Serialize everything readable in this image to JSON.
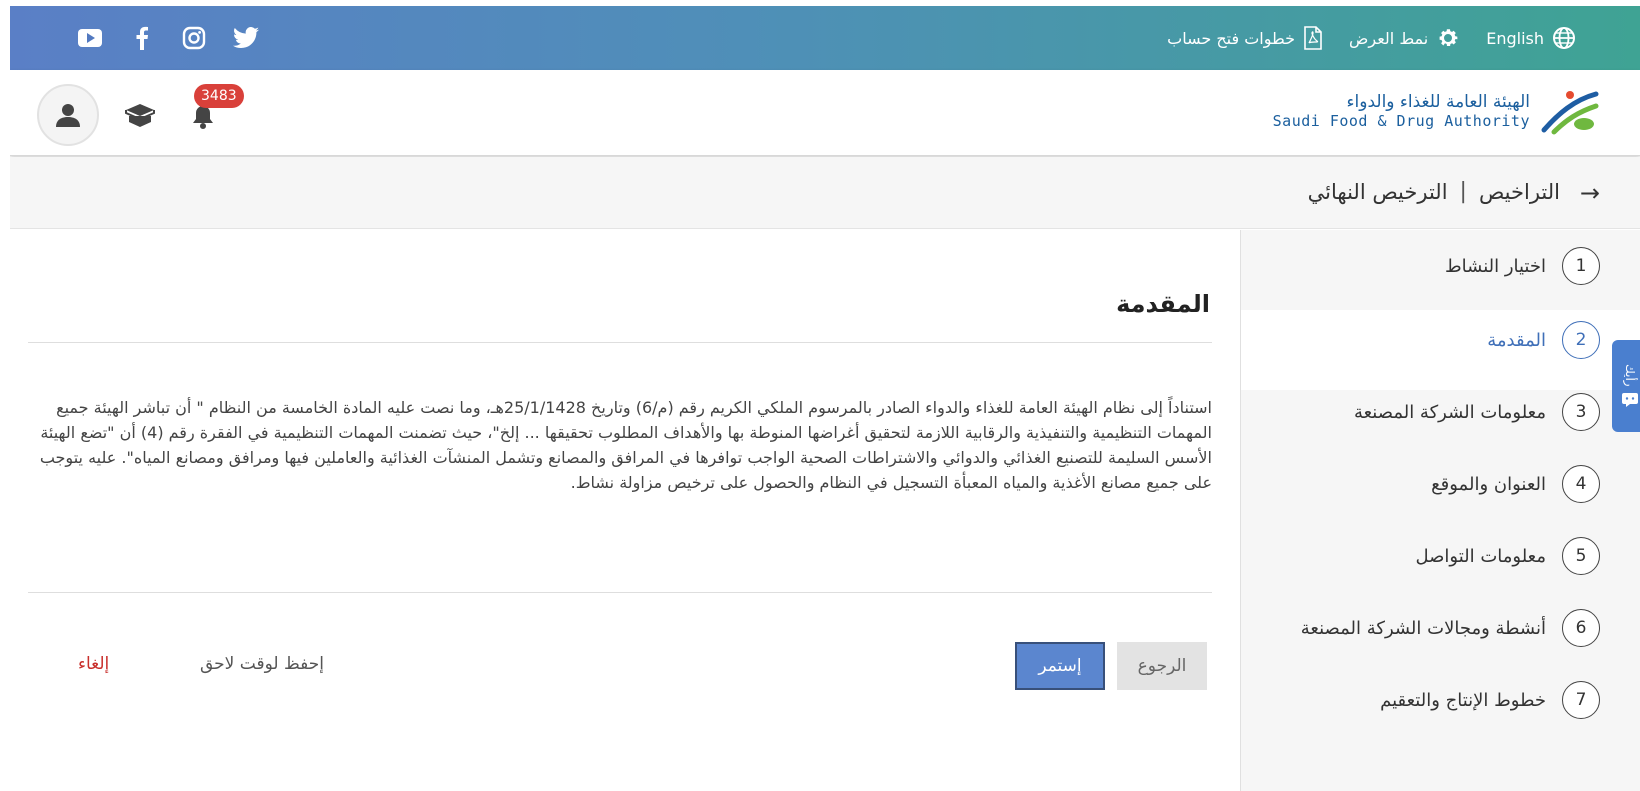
{
  "topbar": {
    "language": "English",
    "display_mode": "نمط العرض",
    "account_steps": "خطوات فتح حساب",
    "social": [
      "youtube-icon",
      "facebook-icon",
      "instagram-icon",
      "twitter-icon"
    ]
  },
  "header": {
    "logo_ar": "الهيئة العامة للغذاء والدواء",
    "logo_en": "Saudi Food & Drug Authority",
    "notification_count": "3483"
  },
  "breadcrumb": {
    "parent": "التراخيص",
    "separator": "|",
    "current": "الترخيص النهائي"
  },
  "steps": [
    {
      "num": "1",
      "label": "اختيار النشاط"
    },
    {
      "num": "2",
      "label": "المقدمة"
    },
    {
      "num": "3",
      "label": "معلومات الشركة المصنعة"
    },
    {
      "num": "4",
      "label": "العنوان والموقع"
    },
    {
      "num": "5",
      "label": "معلومات التواصل"
    },
    {
      "num": "6",
      "label": "أنشطة ومجالات الشركة المصنعة"
    },
    {
      "num": "7",
      "label": "خطوط الإنتاج والتعقيم"
    }
  ],
  "feedback_label": "رأيك",
  "main": {
    "title": "المقدمة",
    "paragraph": "استناداً إلى نظام الهيئة العامة للغذاء والدواء الصادر بالمرسوم الملكي الكريم رقم (م/6) وتاريخ 25/1/1428هـ، وما نصت عليه المادة الخامسة من النظام \" أن تباشر الهيئة جميع المهمات التنظيمية والتنفيذية والرقابية اللازمة لتحقيق أغراضها المنوطة بها والأهداف المطلوب تحقيقها ... إلخ\"، حيث تضمنت المهمات التنظيمية في الفقرة رقم (4) أن \"تضع الهيئة الأسس السليمة للتصنيع الغذائي والدوائي والاشتراطات الصحية الواجب توافرها في المرافق والمصانع وتشمل المنشآت الغذائية والعاملين فيها ومرافق ومصانع المياه\". عليه يتوجب على جميع مصانع الأغذية والمياه المعبأة التسجيل في النظام والحصول على ترخيص مزاولة نشاط.",
    "back_button": "الرجوع",
    "continue_button": "إستمر",
    "save_later": "إحفظ لوقت لاحق",
    "cancel": "إلغاء"
  },
  "colors": {
    "accent": "#3f6fb8",
    "continue_bg": "#5b86cf",
    "cancel_text": "#c9302c",
    "badge_bg": "#d9403a"
  }
}
